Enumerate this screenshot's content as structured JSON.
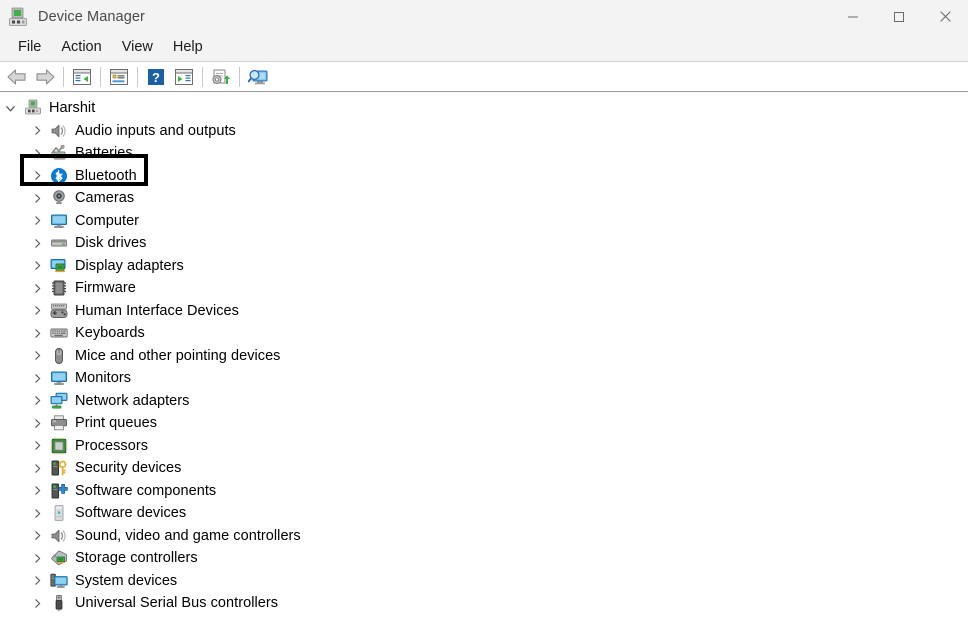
{
  "window": {
    "title": "Device Manager",
    "icon": "device-manager-icon",
    "controls": [
      {
        "name": "minimize-button",
        "glyph": "minimize-icon",
        "label": "Minimize"
      },
      {
        "name": "maximize-button",
        "glyph": "maximize-icon",
        "label": "Maximize"
      },
      {
        "name": "close-button",
        "glyph": "close-icon",
        "label": "Close"
      }
    ]
  },
  "menubar": {
    "items": [
      {
        "label": "File"
      },
      {
        "label": "Action"
      },
      {
        "label": "View"
      },
      {
        "label": "Help"
      }
    ]
  },
  "toolbar": {
    "items": [
      {
        "name": "back-button",
        "icon": "back-arrow-icon",
        "tooltip": "Back"
      },
      {
        "name": "forward-button",
        "icon": "forward-arrow-icon",
        "tooltip": "Forward"
      },
      {
        "name": "separator-1",
        "icon": "separator"
      },
      {
        "name": "show-hide-console-tree-button",
        "icon": "console-tree-icon",
        "tooltip": "Show/Hide Console Tree"
      },
      {
        "name": "separator-2",
        "icon": "separator"
      },
      {
        "name": "properties-button",
        "icon": "properties-icon",
        "tooltip": "Properties"
      },
      {
        "name": "separator-3",
        "icon": "separator"
      },
      {
        "name": "help-button",
        "icon": "help-question-icon",
        "tooltip": "Help"
      },
      {
        "name": "show-hide-action-pane-button",
        "icon": "action-pane-icon",
        "tooltip": "Show/Hide Action Pane"
      },
      {
        "name": "separator-4",
        "icon": "separator"
      },
      {
        "name": "update-driver-button",
        "icon": "update-driver-icon",
        "tooltip": "Update Driver Software"
      },
      {
        "name": "separator-5",
        "icon": "separator"
      },
      {
        "name": "scan-for-hardware-changes-button",
        "icon": "scan-hardware-icon",
        "tooltip": "Scan for hardware changes"
      }
    ]
  },
  "tree": {
    "root": {
      "label": "Harshit",
      "icon": "computer-root-icon",
      "expanded": true,
      "chevron": "chevron-down-icon"
    },
    "children": [
      {
        "label": "Audio inputs and outputs",
        "icon": "speaker-icon",
        "chevron": "chevron-right-icon",
        "highlighted": false
      },
      {
        "label": "Batteries",
        "icon": "battery-icon",
        "chevron": "chevron-right-icon",
        "highlighted": false
      },
      {
        "label": "Bluetooth",
        "icon": "bluetooth-icon",
        "chevron": "chevron-right-icon",
        "highlighted": true
      },
      {
        "label": "Cameras",
        "icon": "camera-icon",
        "chevron": "chevron-right-icon",
        "highlighted": false
      },
      {
        "label": "Computer",
        "icon": "monitor-icon",
        "chevron": "chevron-right-icon",
        "highlighted": false
      },
      {
        "label": "Disk drives",
        "icon": "disk-drive-icon",
        "chevron": "chevron-right-icon",
        "highlighted": false
      },
      {
        "label": "Display adapters",
        "icon": "display-adapter-icon",
        "chevron": "chevron-right-icon",
        "highlighted": false
      },
      {
        "label": "Firmware",
        "icon": "firmware-chip-icon",
        "chevron": "chevron-right-icon",
        "highlighted": false
      },
      {
        "label": "Human Interface Devices",
        "icon": "hid-gamepad-icon",
        "chevron": "chevron-right-icon",
        "highlighted": false
      },
      {
        "label": "Keyboards",
        "icon": "keyboard-icon",
        "chevron": "chevron-right-icon",
        "highlighted": false
      },
      {
        "label": "Mice and other pointing devices",
        "icon": "mouse-icon",
        "chevron": "chevron-right-icon",
        "highlighted": false
      },
      {
        "label": "Monitors",
        "icon": "monitor-icon",
        "chevron": "chevron-right-icon",
        "highlighted": false
      },
      {
        "label": "Network adapters",
        "icon": "network-adapter-icon",
        "chevron": "chevron-right-icon",
        "highlighted": false
      },
      {
        "label": "Print queues",
        "icon": "printer-icon",
        "chevron": "chevron-right-icon",
        "highlighted": false
      },
      {
        "label": "Processors",
        "icon": "processor-chip-icon",
        "chevron": "chevron-right-icon",
        "highlighted": false
      },
      {
        "label": "Security devices",
        "icon": "security-key-icon",
        "chevron": "chevron-right-icon",
        "highlighted": false
      },
      {
        "label": "Software components",
        "icon": "software-component-icon",
        "chevron": "chevron-right-icon",
        "highlighted": false
      },
      {
        "label": "Software devices",
        "icon": "software-device-icon",
        "chevron": "chevron-right-icon",
        "highlighted": false
      },
      {
        "label": "Sound, video and game controllers",
        "icon": "speaker-icon",
        "chevron": "chevron-right-icon",
        "highlighted": false
      },
      {
        "label": "Storage controllers",
        "icon": "storage-controller-icon",
        "chevron": "chevron-right-icon",
        "highlighted": false
      },
      {
        "label": "System devices",
        "icon": "system-device-icon",
        "chevron": "chevron-right-icon",
        "highlighted": false
      },
      {
        "label": "Universal Serial Bus controllers",
        "icon": "usb-icon",
        "chevron": "chevron-right-icon",
        "highlighted": false
      }
    ]
  },
  "annotation": {
    "type": "highlight-rectangle",
    "target": "Bluetooth",
    "color": "#000000",
    "border_width_px": 4
  },
  "colors": {
    "titlebar_bg": "#f3f3f3",
    "content_bg": "#ffffff",
    "text": "#000000",
    "title_text": "#4a4a4a",
    "bluetooth_blue": "#0a7ad4",
    "accent_green": "#3faf46",
    "toolbar_border": "#9a9a9a"
  }
}
